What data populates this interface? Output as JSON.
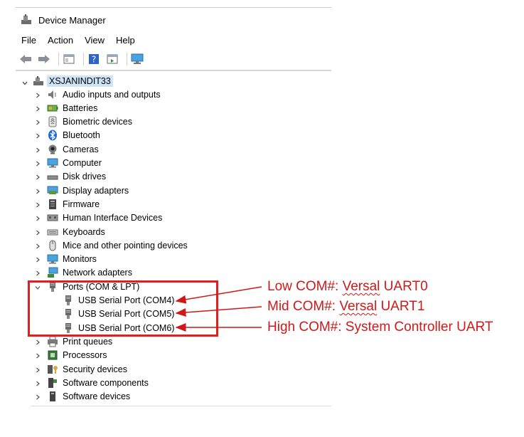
{
  "window": {
    "title": "Device Manager"
  },
  "menu": {
    "items": [
      "File",
      "Action",
      "View",
      "Help"
    ]
  },
  "toolbar": {
    "buttons": [
      {
        "icon": "back-arrow-icon"
      },
      {
        "icon": "forward-arrow-icon"
      },
      {
        "icon": "properties-icon"
      },
      {
        "icon": "help-icon"
      },
      {
        "icon": "update-driver-icon"
      },
      {
        "icon": "scan-hardware-icon"
      }
    ]
  },
  "tree": {
    "root": {
      "label": "XSJANINDIT33",
      "icon": "computer-icon",
      "expanded": true
    },
    "categories": [
      {
        "label": "Audio inputs and outputs",
        "icon": "speaker-icon"
      },
      {
        "label": "Batteries",
        "icon": "battery-icon"
      },
      {
        "label": "Biometric devices",
        "icon": "fingerprint-icon"
      },
      {
        "label": "Bluetooth",
        "icon": "bluetooth-icon"
      },
      {
        "label": "Cameras",
        "icon": "camera-icon"
      },
      {
        "label": "Computer",
        "icon": "monitor-icon"
      },
      {
        "label": "Disk drives",
        "icon": "disk-drive-icon"
      },
      {
        "label": "Display adapters",
        "icon": "display-adapter-icon"
      },
      {
        "label": "Firmware",
        "icon": "firmware-icon"
      },
      {
        "label": "Human Interface Devices",
        "icon": "hid-icon"
      },
      {
        "label": "Keyboards",
        "icon": "keyboard-icon"
      },
      {
        "label": "Mice and other pointing devices",
        "icon": "mouse-icon"
      },
      {
        "label": "Monitors",
        "icon": "monitor-icon"
      },
      {
        "label": "Network adapters",
        "icon": "network-adapter-icon"
      },
      {
        "label": "Ports (COM & LPT)",
        "icon": "port-icon",
        "expanded": true,
        "children": [
          {
            "label": "USB Serial Port (COM4)",
            "icon": "port-icon"
          },
          {
            "label": "USB Serial Port (COM5)",
            "icon": "port-icon"
          },
          {
            "label": "USB Serial Port (COM6)",
            "icon": "port-icon"
          }
        ]
      },
      {
        "label": "Print queues",
        "icon": "printer-icon"
      },
      {
        "label": "Processors",
        "icon": "processor-icon"
      },
      {
        "label": "Security devices",
        "icon": "security-device-icon"
      },
      {
        "label": "Software components",
        "icon": "software-component-icon"
      },
      {
        "label": "Software devices",
        "icon": "software-device-icon"
      }
    ]
  },
  "annotations": [
    {
      "prefix": "Low COM#: ",
      "squiggle": "Versal",
      "suffix": " UART0"
    },
    {
      "prefix": "Mid COM#: ",
      "squiggle": "Versal",
      "suffix": " UART1"
    },
    {
      "prefix": "High COM#: System Controller UART",
      "squiggle": "",
      "suffix": ""
    }
  ],
  "colors": {
    "annotation": "#d01818",
    "root_highlight": "#cfe5f7"
  }
}
